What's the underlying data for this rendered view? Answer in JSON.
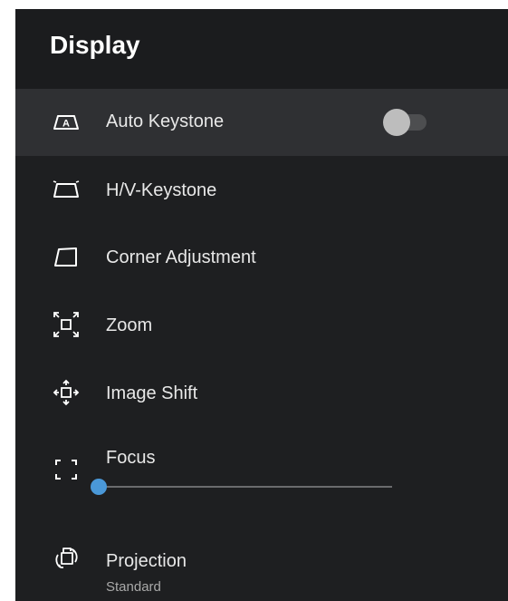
{
  "header": {
    "title": "Display"
  },
  "items": [
    {
      "label": "Auto Keystone",
      "icon": "auto-keystone-icon",
      "toggle": {
        "on": false
      }
    },
    {
      "label": "H/V-Keystone",
      "icon": "keystone-icon"
    },
    {
      "label": "Corner Adjustment",
      "icon": "corner-adjustment-icon"
    },
    {
      "label": "Zoom",
      "icon": "zoom-icon"
    },
    {
      "label": "Image Shift",
      "icon": "image-shift-icon"
    },
    {
      "label": "Focus",
      "icon": "focus-icon",
      "slider": {
        "value_fraction": 0.0
      }
    },
    {
      "label": "Projection",
      "icon": "projection-icon",
      "value": "Standard"
    }
  ],
  "colors": {
    "background": "#1e1f21",
    "header": "#1b1c1e",
    "selected_row": "#2f3033",
    "accent": "#4a98d8",
    "toggle_knob": "#bdbdbd",
    "toggle_track": "#4d4e50"
  }
}
